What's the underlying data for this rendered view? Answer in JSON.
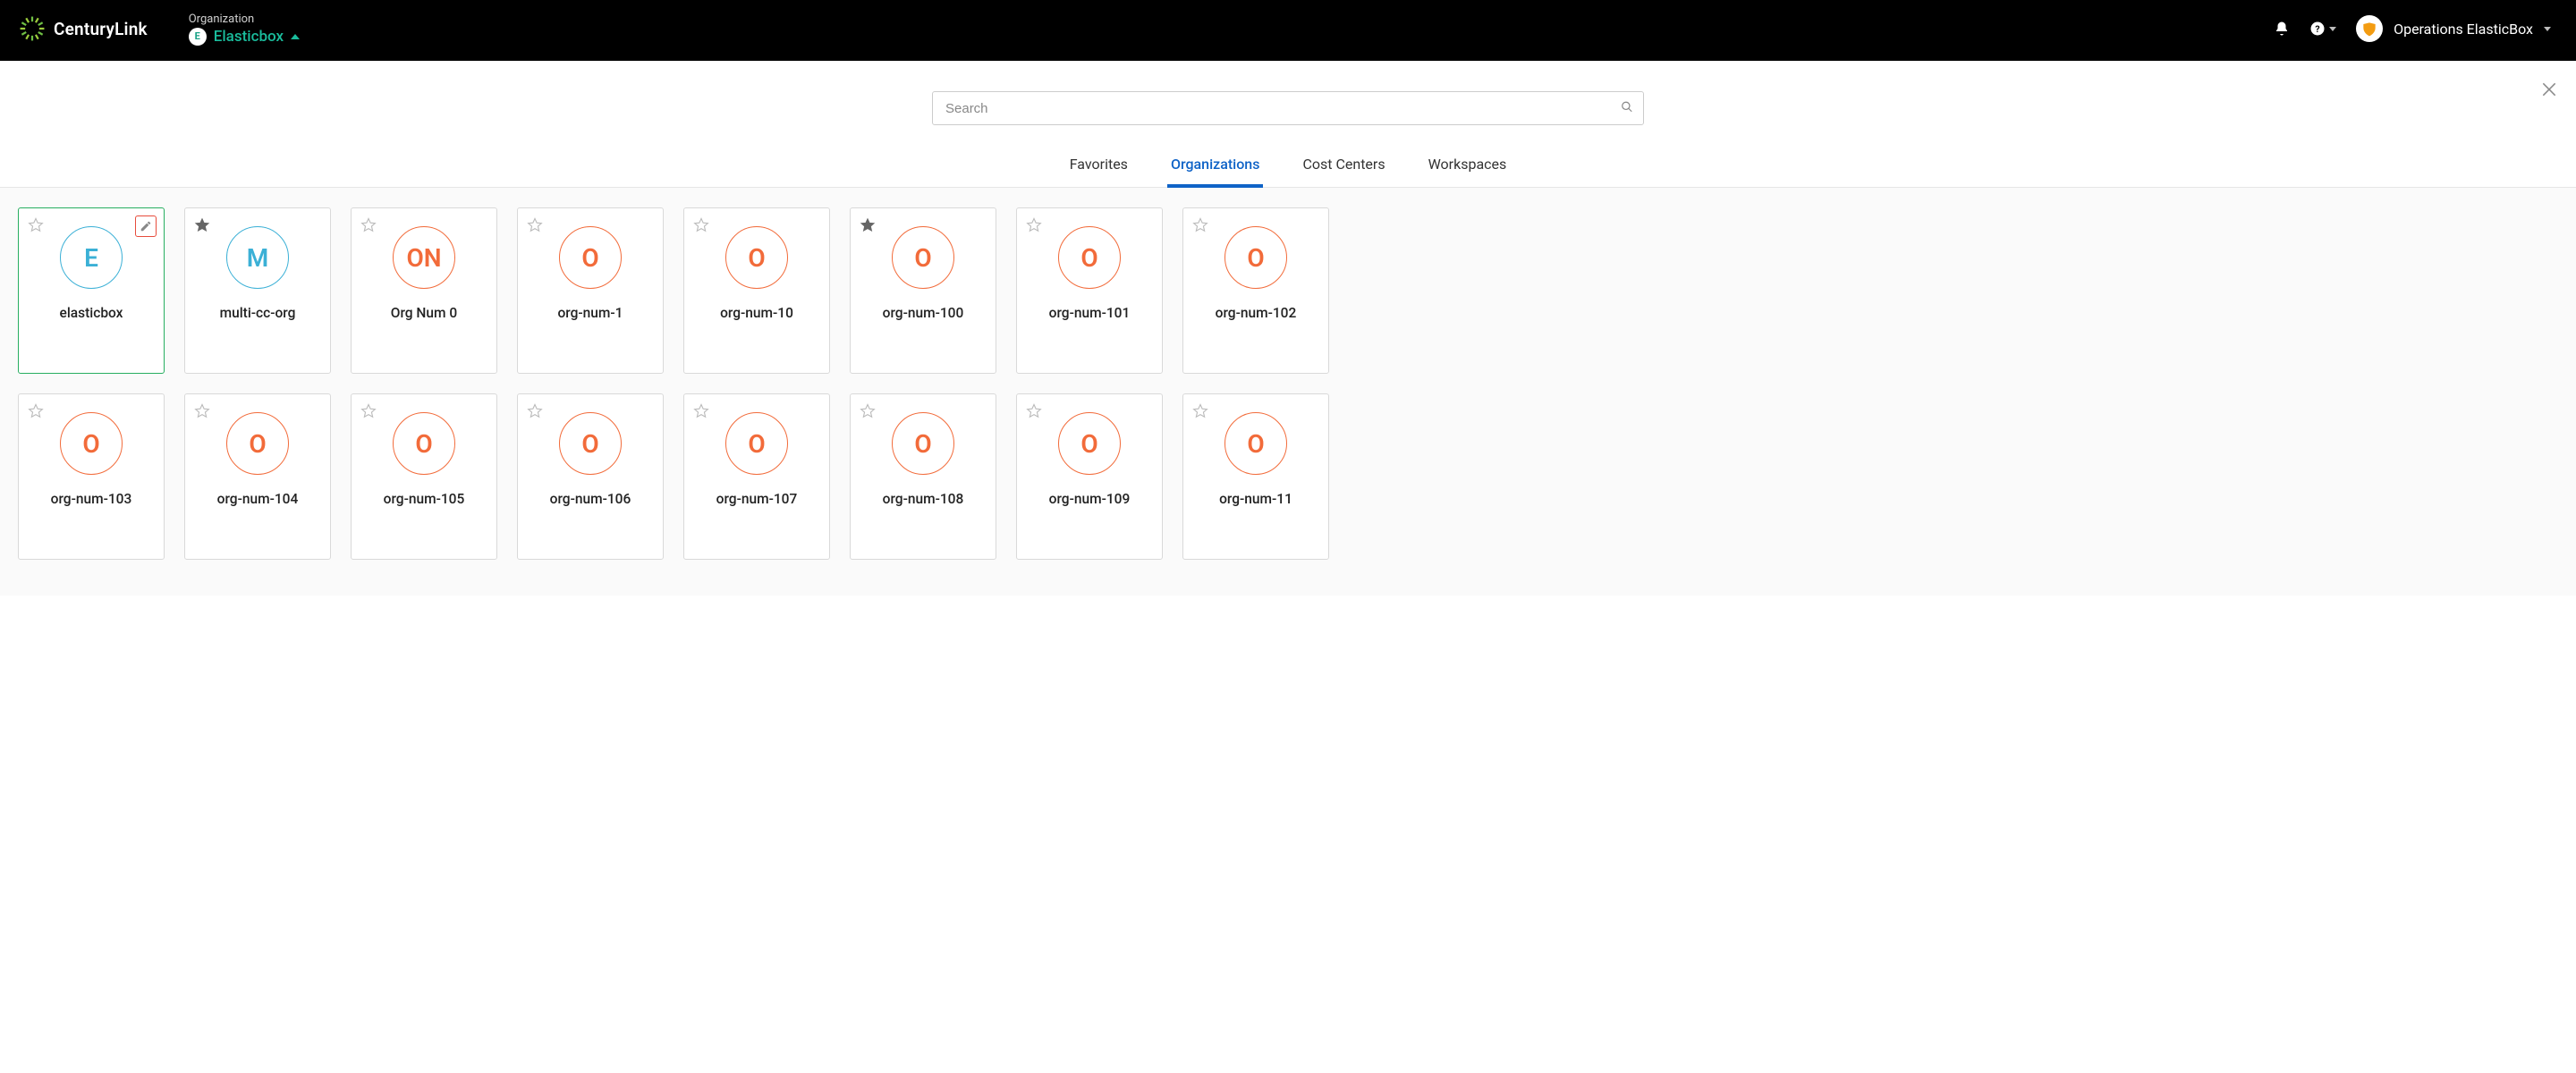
{
  "brand": "CenturyLink",
  "header": {
    "org_label": "Organization",
    "org_name": "Elasticbox",
    "org_badge_letter": "E",
    "user_name": "Operations ElasticBox"
  },
  "search": {
    "placeholder": "Search"
  },
  "tabs": [
    {
      "label": "Favorites",
      "active": false
    },
    {
      "label": "Organizations",
      "active": true
    },
    {
      "label": "Cost Centers",
      "active": false
    },
    {
      "label": "Workspaces",
      "active": false
    }
  ],
  "cards": [
    {
      "letter": "E",
      "label": "elasticbox",
      "color": "blue",
      "favorite": false,
      "selected": true,
      "editable": true
    },
    {
      "letter": "M",
      "label": "multi-cc-org",
      "color": "blue",
      "favorite": true,
      "selected": false,
      "editable": false
    },
    {
      "letter": "ON",
      "label": "Org Num 0",
      "color": "orange",
      "favorite": false,
      "selected": false,
      "editable": false
    },
    {
      "letter": "O",
      "label": "org-num-1",
      "color": "orange",
      "favorite": false,
      "selected": false,
      "editable": false
    },
    {
      "letter": "O",
      "label": "org-num-10",
      "color": "orange",
      "favorite": false,
      "selected": false,
      "editable": false
    },
    {
      "letter": "O",
      "label": "org-num-100",
      "color": "orange",
      "favorite": true,
      "selected": false,
      "editable": false
    },
    {
      "letter": "O",
      "label": "org-num-101",
      "color": "orange",
      "favorite": false,
      "selected": false,
      "editable": false
    },
    {
      "letter": "O",
      "label": "org-num-102",
      "color": "orange",
      "favorite": false,
      "selected": false,
      "editable": false
    },
    {
      "letter": "O",
      "label": "org-num-103",
      "color": "orange",
      "favorite": false,
      "selected": false,
      "editable": false
    },
    {
      "letter": "O",
      "label": "org-num-104",
      "color": "orange",
      "favorite": false,
      "selected": false,
      "editable": false
    },
    {
      "letter": "O",
      "label": "org-num-105",
      "color": "orange",
      "favorite": false,
      "selected": false,
      "editable": false
    },
    {
      "letter": "O",
      "label": "org-num-106",
      "color": "orange",
      "favorite": false,
      "selected": false,
      "editable": false
    },
    {
      "letter": "O",
      "label": "org-num-107",
      "color": "orange",
      "favorite": false,
      "selected": false,
      "editable": false
    },
    {
      "letter": "O",
      "label": "org-num-108",
      "color": "orange",
      "favorite": false,
      "selected": false,
      "editable": false
    },
    {
      "letter": "O",
      "label": "org-num-109",
      "color": "orange",
      "favorite": false,
      "selected": false,
      "editable": false
    },
    {
      "letter": "O",
      "label": "org-num-11",
      "color": "orange",
      "favorite": false,
      "selected": false,
      "editable": false
    }
  ]
}
